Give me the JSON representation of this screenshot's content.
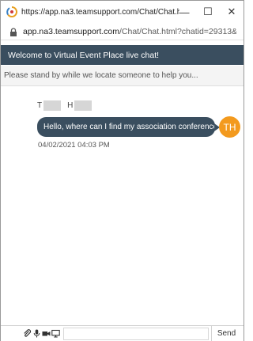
{
  "window": {
    "title": "https://app.na3.teamsupport.com/Chat/Chat.html?c...",
    "minimize_glyph": "—",
    "maximize_glyph": "☐",
    "close_glyph": "✕"
  },
  "address_bar": {
    "url_host": "app.na3.teamsupport.com",
    "url_path": "/Chat/Chat.html?chatid=29313&pid..."
  },
  "chat": {
    "welcome": "Welcome to Virtual Event Place live chat!",
    "standby": "Please stand by while we locate someone to help you...",
    "sender_first_initial": "T",
    "sender_last_initial": "H",
    "message": "Hello, where can I find my association conference?",
    "avatar_initials": "TH",
    "timestamp": "04/02/2021 04:03 PM"
  },
  "composer": {
    "input_value": "",
    "input_placeholder": "",
    "send_label": "Send"
  },
  "colors": {
    "header_bg": "#3a4e5f",
    "bubble_bg": "#3a4e5f",
    "avatar_bg": "#f39a1e"
  },
  "icons": [
    "browser-icon",
    "lock-icon",
    "attach-icon",
    "mic-icon",
    "video-icon",
    "screen-share-icon"
  ]
}
